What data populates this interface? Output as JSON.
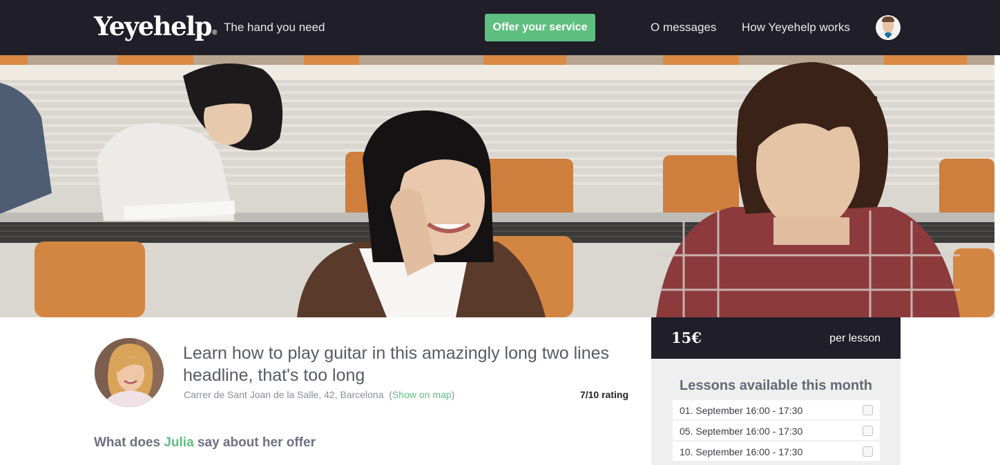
{
  "header": {
    "logo": "Yeyehelp",
    "logo_mark": "®",
    "tagline": "The hand you need",
    "offer_button": "Offer your service",
    "messages_link": "O messages",
    "how_link": "How Yeyehelp works"
  },
  "offer": {
    "headline": "Learn how to play guitar in this amazingly long two lines headline, that's too long",
    "address": "Carrer de Sant Joan de la Salle, 42, Barcelona",
    "map_open": "(",
    "map_link": "Show on map",
    "map_close": ")",
    "rating": "7/10 rating",
    "about_prefix": "What does",
    "about_name": "Julia",
    "about_suffix": "say about her offer"
  },
  "pricing": {
    "price": "15€",
    "unit": "per lesson",
    "lessons_title": "Lessons available this month",
    "lessons": [
      {
        "label": "01. September 16:00 - 17:30",
        "checked": false
      },
      {
        "label": "05. September 16:00 - 17:30",
        "checked": false
      },
      {
        "label": "10. September 16:00 - 17:30",
        "checked": false
      }
    ]
  },
  "colors": {
    "header_bg": "#1f1e29",
    "accent_green": "#5fbf80",
    "card_bg": "#efefef"
  }
}
